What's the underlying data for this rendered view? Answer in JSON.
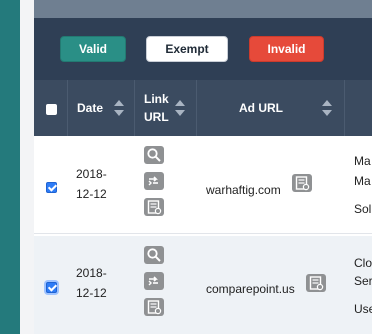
{
  "toolbar": {
    "valid_label": "Valid",
    "exempt_label": "Exempt",
    "invalid_label": "Invalid"
  },
  "table": {
    "headers": {
      "date": "Date",
      "link_url_line1": "Link",
      "link_url_line2": "URL",
      "ad_url": "Ad URL"
    },
    "rows": [
      {
        "selected": true,
        "date_line1": "2018-",
        "date_line2": "12-12",
        "ad_url": "warhaftig.com",
        "next_col_lines": [
          "Ma",
          "Ma",
          "Sol"
        ]
      },
      {
        "selected": true,
        "date_line1": "2018-",
        "date_line2": "12-12",
        "ad_url": "comparepoint.us",
        "next_col_lines": [
          "Clo",
          "Ser",
          "Use"
        ]
      }
    ]
  },
  "colors": {
    "rail": "#247a7c",
    "toolbar": "#2f3f55",
    "header": "#3b4b60",
    "valid": "#2a8f86",
    "invalid": "#e64a3a",
    "checkbox_checked": "#2e7cf6",
    "icon_bg": "#8f9193"
  },
  "icons": {
    "link_actions": [
      "search-icon",
      "redirect-icon",
      "details-icon"
    ],
    "ad_url_action": "details-icon"
  }
}
